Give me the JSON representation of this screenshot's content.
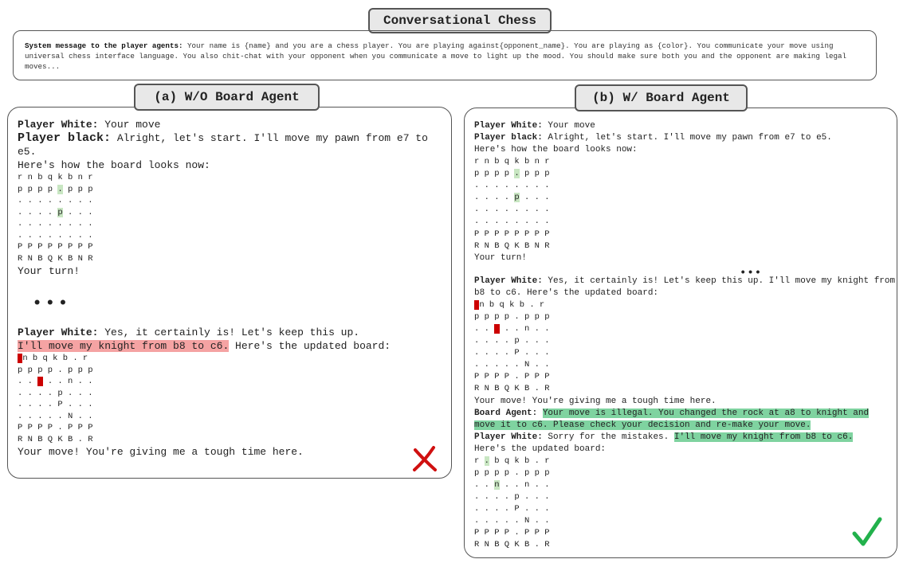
{
  "title": "Conversational Chess",
  "system": {
    "label": "System message to the player agents:",
    "text": " Your name is {name} and you are a chess player. You are playing against{opponent_name}. You are playing as {color}. You communicate your move using universal chess interface language. You also chit-chat with your opponent when you communicate a move to light up the mood. You should make sure both you and the opponent are making legal moves..."
  },
  "panel_a": {
    "label": "(a) W/O Board Agent",
    "w1_name": "Player White:",
    "w1_text": " Your move",
    "b1_name": "Player black:",
    "b1_text": " Alright, let's start. I'll move my pawn from e7 to e5.",
    "b1_line2": "Here's how the board looks now:",
    "board1": {
      "r1": "r n b q k b n r",
      "r2a": "p p p p ",
      "r2h": ".",
      "r2b": " p p p",
      "r3": ". . . . . . . .",
      "r4a": ". . . . ",
      "r4h": "p",
      "r4b": " . . .",
      "r5": ". . . . . . . .",
      "r6": ". . . . . . . .",
      "r7": "P P P P P P P P",
      "r8": "R N B Q K B N R"
    },
    "turn": "Your turn!",
    "ellipsis": "•••",
    "w2_name": "Player White:",
    "w2_text": " Yes, it certainly is! Let's keep this up.",
    "w2_hl": "I'll move my knight from b8 to c6.",
    "w2_rest": " Here's the updated board:",
    "board2": {
      "r1h": "r",
      "r1b": "n b q k b . r",
      "r2": "p p p p . p p p",
      "r3a": ". . ",
      "r3h": "n",
      "r3b": " . . n . .",
      "r4": ". . . . p . . .",
      "r5": ". . . . P . . .",
      "r6": ". . . . . N . .",
      "r7": "P P P P . P P P",
      "r8": "R N B Q K B . R"
    },
    "closing": "Your move! You're giving me a tough time here.",
    "mark": "✗"
  },
  "panel_b": {
    "label": "(b) W/ Board Agent",
    "w1_name": "Player White:",
    "w1_text": " Your move",
    "b1_name": "Player black:",
    "b1_text": " Alright, let's start. I'll move my pawn from e7 to e5.",
    "b1_line2": "Here's how the board looks now:",
    "board1": {
      "r1": "r n b q k b n r",
      "r2a": "p p p p ",
      "r2h": ".",
      "r2b": " p p p",
      "r3": ". . . . . . . .",
      "r4a": ". . . . ",
      "r4h": "p",
      "r4b": " . . .",
      "r5": ". . . . . . . .",
      "r6": ". . . . . . . .",
      "r7": "P P P P P P P P",
      "r8": "R N B Q K B N R"
    },
    "turn": "Your turn!",
    "ellipsis": "•••",
    "w2_name": "Player White:",
    "w2_text": " Yes, it certainly is! Let's keep this up. I'll move my knight from b8 to c6. Here's the updated board:",
    "board2": {
      "r1h": "r",
      "r1b": "n b q k b . r",
      "r2": "p p p p . p p p",
      "r3a": ". . ",
      "r3h": "n",
      "r3b": " . . n . .",
      "r4": ". . . . p . . .",
      "r5": ". . . . P . . .",
      "r6": ". . . . . N . .",
      "r7": "P P P P . P P P",
      "r8": "R N B Q K B . R"
    },
    "closing": "Your move! You're giving me a tough time here.",
    "agent_name": "Board Agent:",
    "agent_text": "Your move is illegal. You changed the rock at a8 to knight and move it to c6. Please check your decision and re-make your move.",
    "w3_name": "Player White:",
    "w3_text": " Sorry for the mistakes. ",
    "w3_hl": "I'll move my knight from b8 to c6.",
    "w3_line2": "Here's the updated board:",
    "board3": {
      "r1a": "r ",
      "r1h": ".",
      "r1b": " b q k b . r",
      "r2": "p p p p . p p p",
      "r3a": ". . ",
      "r3h": "n",
      "r3b": " . . n . .",
      "r4": ". . . . p . . .",
      "r5": ". . . . P . . .",
      "r6": ". . . . . N . .",
      "r7": "P P P P . P P P",
      "r8": "R N B Q K B . R"
    },
    "mark": "✓"
  }
}
